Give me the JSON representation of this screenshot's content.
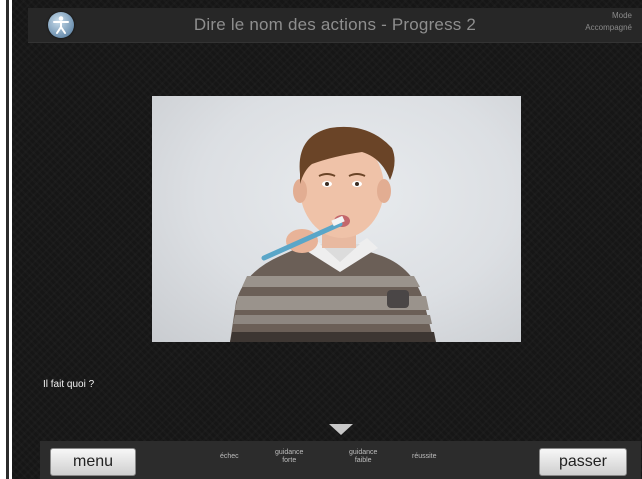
{
  "header": {
    "title": "Dire le nom des actions - Progress 2",
    "mode_line1": "Mode",
    "mode_line2": "Accompagné",
    "logo_icon": "accessibility-person-icon"
  },
  "question": "Il fait quoi ?",
  "photo": {
    "subject": "boy brushing teeth"
  },
  "toggle_icon": "triangle-down-icon",
  "footer": {
    "menu_label": "menu",
    "passer_label": "passer",
    "evaluation": [
      {
        "line1": "échec",
        "line2": ""
      },
      {
        "line1": "guidance",
        "line2": "forte"
      },
      {
        "line1": "guidance",
        "line2": "faible"
      },
      {
        "line1": "réussite",
        "line2": ""
      }
    ]
  },
  "colors": {
    "background": "#161616",
    "bar": "#272727",
    "button": "#e6e6e6"
  }
}
